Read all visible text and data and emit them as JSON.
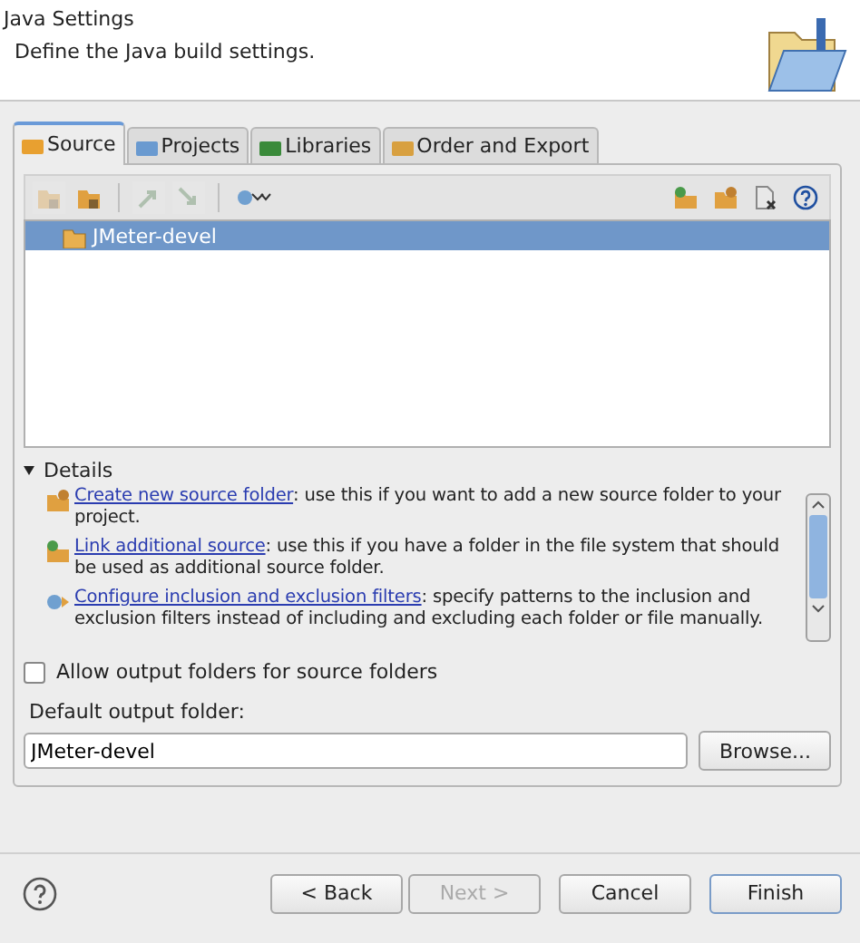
{
  "header": {
    "title": "Java Settings",
    "description": "Define the Java build settings."
  },
  "tabs": [
    {
      "label": "Source",
      "selected": true
    },
    {
      "label": "Projects",
      "selected": false
    },
    {
      "label": "Libraries",
      "selected": false
    },
    {
      "label": "Order and Export",
      "selected": false
    }
  ],
  "toolbar": {
    "left": [
      {
        "disabled": true
      },
      {
        "disabled": false
      },
      {
        "disabled": true
      },
      {
        "disabled": true
      },
      {
        "disabled": false
      }
    ],
    "right": [
      {
        "disabled": false
      },
      {
        "disabled": false
      },
      {
        "disabled": false
      },
      {
        "disabled": false
      }
    ]
  },
  "tree": [
    {
      "label": "JMeter-devel",
      "selected": true
    }
  ],
  "details": {
    "label": "Details",
    "expanded": true,
    "items": [
      {
        "link": "Create new source folder",
        "text": ": use this if you want to add a new source folder to your project."
      },
      {
        "link": "Link additional source",
        "text": ": use this if you have a folder in the file system that should be used as additional source folder."
      },
      {
        "link": "Configure inclusion and exclusion filters",
        "text": ": specify patterns to the inclusion and exclusion filters instead of including and excluding each folder or file manually."
      }
    ]
  },
  "allow_output": {
    "label": "Allow output folders for source folders",
    "checked": false
  },
  "output": {
    "label": "Default output folder:",
    "value": "JMeter-devel",
    "button": "Browse..."
  },
  "buttons": [
    {
      "label": "< Back",
      "disabled": false,
      "default": false
    },
    {
      "label": "Next >",
      "disabled": true,
      "default": false
    },
    {
      "label": "Cancel",
      "disabled": false,
      "default": false
    },
    {
      "label": "Finish",
      "disabled": false,
      "default": true
    }
  ]
}
